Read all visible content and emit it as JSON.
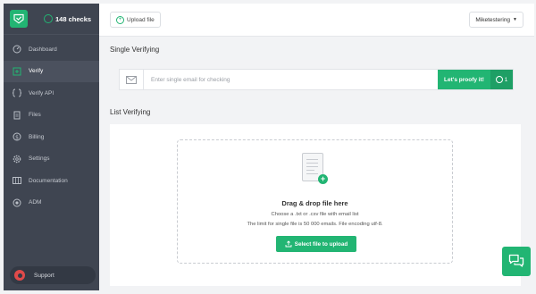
{
  "sidebar": {
    "checks_label": "148 checks",
    "items": [
      {
        "label": "Dashboard",
        "icon": "dashboard-icon"
      },
      {
        "label": "Verify",
        "icon": "verify-icon",
        "active": true
      },
      {
        "label": "Verify API",
        "icon": "api-icon"
      },
      {
        "label": "Files",
        "icon": "files-icon"
      },
      {
        "label": "Billing",
        "icon": "billing-icon"
      },
      {
        "label": "Settings",
        "icon": "settings-icon"
      },
      {
        "label": "Documentation",
        "icon": "documentation-icon"
      },
      {
        "label": "ADM",
        "icon": "adm-icon"
      }
    ],
    "support_label": "Support"
  },
  "topbar": {
    "upload_label": "Upload file",
    "user_label": "Miketestering"
  },
  "single": {
    "title": "Single Verifying",
    "placeholder": "Enter single email for checking",
    "button_label": "Let's proofy it!",
    "count": "1"
  },
  "list": {
    "title": "List Verifying",
    "drop_title": "Drag & drop file here",
    "line1": "Choose a .txt or .csv file with email list",
    "line2": "The limit for single file is 50 000 emails. File encoding utf-8.",
    "button_label": "Select file to upload"
  },
  "colors": {
    "accent": "#22b573",
    "sidebar_bg": "#3f4551"
  }
}
